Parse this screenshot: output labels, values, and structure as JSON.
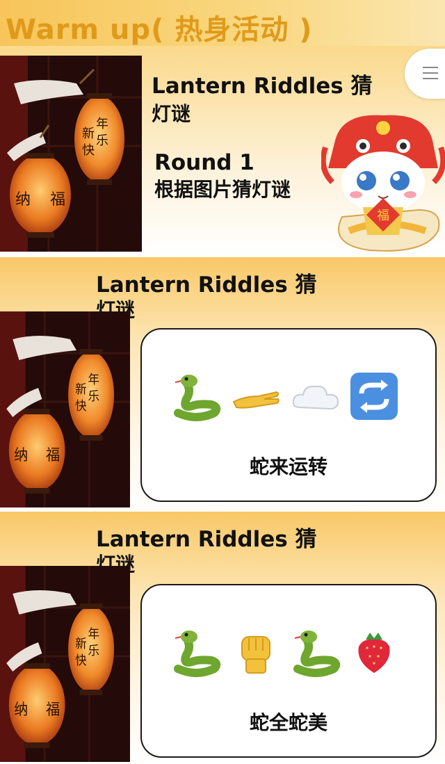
{
  "header": {
    "title": "Warm up( 热身活动 )"
  },
  "slide1": {
    "title_line1": "Lantern Riddles   猜",
    "title_line2": "灯谜",
    "round_label": "Round 1",
    "round_desc": "根据图片猜灯谜"
  },
  "slide2": {
    "title_line1": "Lantern Riddles   猜",
    "title_line2": "灯谜",
    "emojis": [
      "snake-emoji",
      "open-hand-emoji",
      "cloud-emoji",
      "repeat-arrows-emoji"
    ],
    "answer": "蛇来运转"
  },
  "slide3": {
    "title_line1": "Lantern Riddles   猜",
    "title_line2": "灯谜",
    "emojis": [
      "snake-emoji",
      "raised-fist-emoji",
      "snake-emoji",
      "strawberry-emoji"
    ],
    "answer": "蛇全蛇美"
  },
  "lantern_text": {
    "small_chars": [
      "新",
      "年",
      "快",
      "乐"
    ],
    "big_left": "纳",
    "big_right": "福"
  },
  "mascot_badge": "福",
  "colors": {
    "header_text": "#e09a1b",
    "slide_bg": "#fbd98c",
    "card_border": "#1a1a1a",
    "snake": "#7fb33a",
    "lantern": "#f07a20"
  }
}
